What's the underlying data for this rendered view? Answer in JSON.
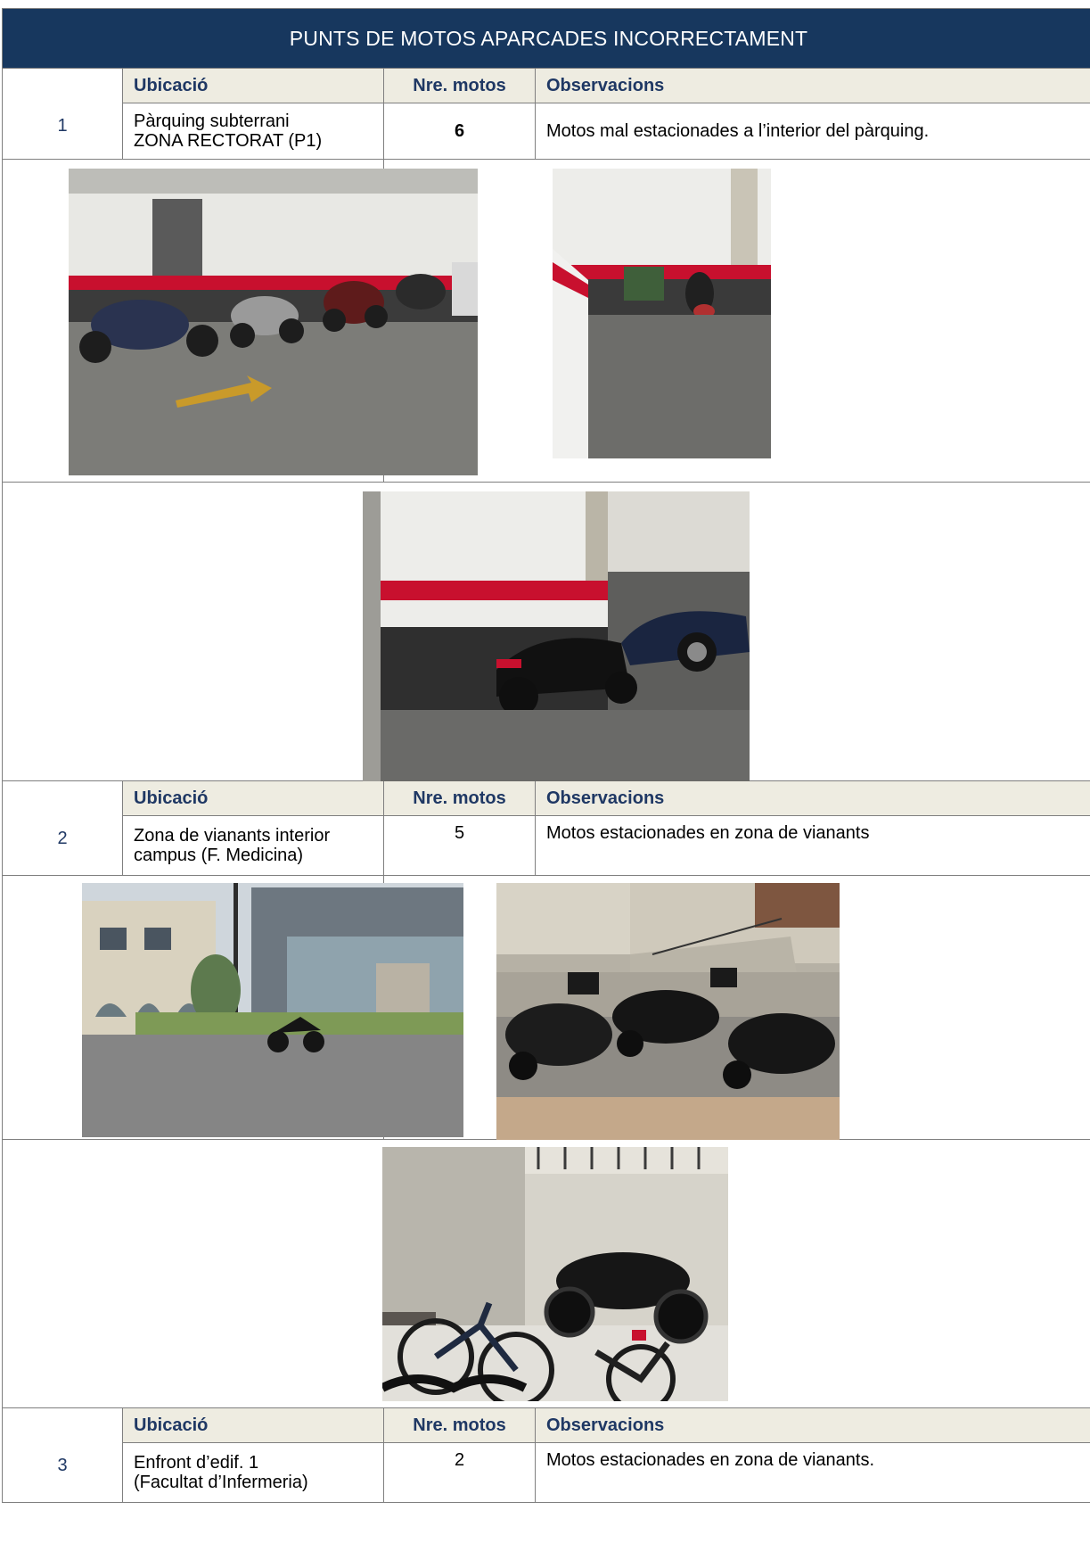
{
  "title": "PUNTS DE MOTOS APARCADES INCORRECTAMENT",
  "headers": {
    "location": "Ubicació",
    "count": "Nre. motos",
    "observations": "Observacions"
  },
  "entries": [
    {
      "number": "1",
      "location_line1": "Pàrquing subterrani",
      "location_line2": "ZONA RECTORAT (P1)",
      "count": "6",
      "observations": "Motos mal estacionades a l’interior del pàrquing."
    },
    {
      "number": "2",
      "location_line1": "Zona de vianants interior",
      "location_line2": "campus (F. Medicina)",
      "count": "5",
      "observations": "Motos estacionades en zona de vianants"
    },
    {
      "number": "3",
      "location_line1": "Enfront d’edif. 1",
      "location_line2": "(Facultat d’Infermeria)",
      "count": "2",
      "observations": "Motos estacionades en zona de vianants."
    }
  ],
  "colors": {
    "title_bg": "#17375e",
    "header_bg": "#eeece1",
    "header_text": "#1f3864",
    "wall_stripe": "#c8102e"
  }
}
